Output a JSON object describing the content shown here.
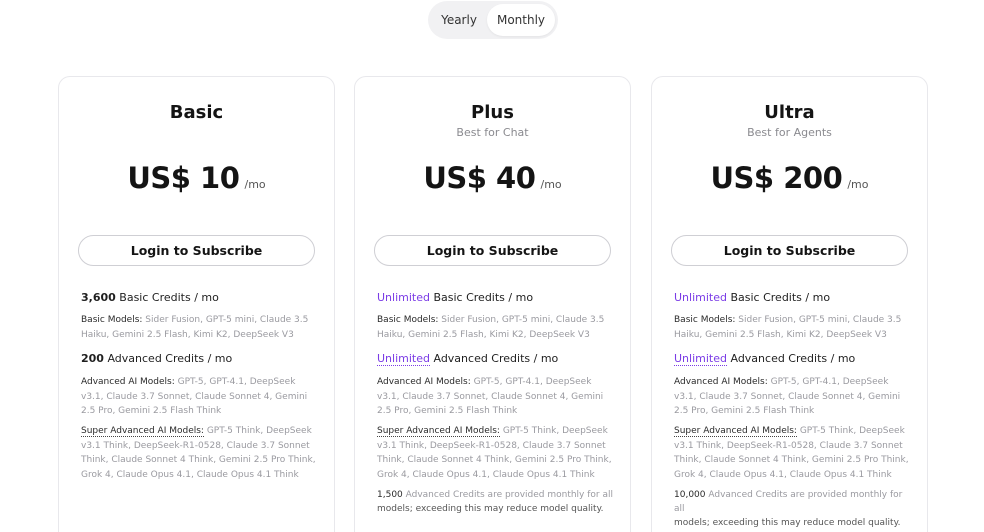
{
  "billing_toggle": {
    "yearly_label": "Yearly",
    "monthly_label": "Monthly",
    "selected": "Monthly"
  },
  "plans": [
    {
      "name": "Basic",
      "subtitle": "",
      "price": "US$ 10",
      "period": "/mo",
      "button": "Login to Subscribe",
      "basic_credits_value": "3,600",
      "basic_credits_label": " Basic Credits / mo",
      "basic_models_label": "Basic Models:",
      "basic_models": " Sider Fusion, GPT-5 mini, Claude 3.5 Haiku, Gemini 2.5 Flash, Kimi K2, DeepSeek V3",
      "advanced_credits_value": "200",
      "advanced_credits_label": " Advanced Credits / mo",
      "advanced_models_label": "Advanced AI Models:",
      "advanced_models": " GPT-5, GPT-4.1, DeepSeek v3.1, Claude 3.7 Sonnet, Claude Sonnet 4, Gemini 2.5 Pro, Gemini 2.5 Flash Think",
      "super_models_label": "Super Advanced AI Models:",
      "super_models": " GPT-5 Think, DeepSeek v3.1 Think, DeepSeek-R1-0528, Claude 3.7 Sonnet Think, Claude Sonnet 4 Think, Gemini 2.5 Pro Think, Grok 4, Claude Opus 4.1, Claude Opus 4.1 Think"
    },
    {
      "name": "Plus",
      "subtitle": "Best for Chat",
      "price": "US$ 40",
      "period": "/mo",
      "button": "Login to Subscribe",
      "basic_credits_value": "Unlimited",
      "basic_credits_label": " Basic Credits / mo",
      "basic_models_label": "Basic Models:",
      "basic_models": " Sider Fusion, GPT-5 mini, Claude 3.5 Haiku, Gemini 2.5 Flash, Kimi K2, DeepSeek V3",
      "advanced_credits_value": "Unlimited",
      "advanced_credits_label": " Advanced Credits / mo",
      "advanced_models_label": "Advanced AI Models:",
      "advanced_models": " GPT-5, GPT-4.1, DeepSeek v3.1, Claude 3.7 Sonnet, Claude Sonnet 4, Gemini 2.5 Pro, Gemini 2.5 Flash Think",
      "super_models_label": "Super Advanced AI Models:",
      "super_models": " GPT-5 Think, DeepSeek v3.1 Think, DeepSeek-R1-0528, Claude 3.7 Sonnet Think, Claude Sonnet 4 Think, Gemini 2.5 Pro Think, Grok 4, Claude Opus 4.1, Claude Opus 4.1 Think",
      "note_value": "1,500",
      "note_text": " Advanced Credits are provided monthly for all",
      "note_tail": "models; exceeding this may reduce model quality."
    },
    {
      "name": "Ultra",
      "subtitle": "Best for Agents",
      "price": "US$ 200",
      "period": "/mo",
      "button": "Login to Subscribe",
      "basic_credits_value": "Unlimited",
      "basic_credits_label": " Basic Credits / mo",
      "basic_models_label": "Basic Models:",
      "basic_models": " Sider Fusion, GPT-5 mini, Claude 3.5 Haiku, Gemini 2.5 Flash, Kimi K2, DeepSeek V3",
      "advanced_credits_value": "Unlimited",
      "advanced_credits_label": " Advanced Credits / mo",
      "advanced_models_label": "Advanced AI Models:",
      "advanced_models": " GPT-5, GPT-4.1, DeepSeek v3.1, Claude 3.7 Sonnet, Claude Sonnet 4, Gemini 2.5 Pro, Gemini 2.5 Flash Think",
      "super_models_label": "Super Advanced AI Models:",
      "super_models": " GPT-5 Think, DeepSeek v3.1 Think, DeepSeek-R1-0528, Claude 3.7 Sonnet Think, Claude Sonnet 4 Think, Gemini 2.5 Pro Think, Grok 4, Claude Opus 4.1, Claude Opus 4.1 Think",
      "note_value": "10,000",
      "note_text": " Advanced Credits are provided monthly for all",
      "note_tail": "models; exceeding this may reduce model quality."
    }
  ],
  "colors": {
    "accent": "#7b3ce6",
    "muted": "#9a9aa0",
    "border": "#e8e8ec",
    "toggle_bg": "#f1f1f3"
  }
}
